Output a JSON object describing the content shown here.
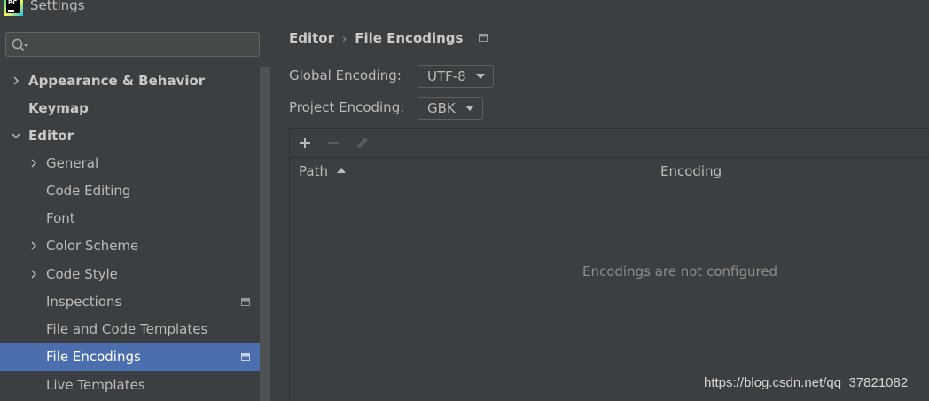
{
  "window": {
    "title": "Settings",
    "app_logo_text": "PC"
  },
  "sidebar": {
    "search": {
      "value": "",
      "placeholder": ""
    },
    "items": [
      {
        "label": "Appearance & Behavior",
        "bold": true,
        "expandable": true
      },
      {
        "label": "Keymap",
        "bold": true,
        "expandable": false
      },
      {
        "label": "Editor",
        "bold": true,
        "expandable": true,
        "expanded": true
      },
      {
        "label": "General",
        "expandable": true
      },
      {
        "label": "Code Editing"
      },
      {
        "label": "Font"
      },
      {
        "label": "Color Scheme",
        "expandable": true
      },
      {
        "label": "Code Style",
        "expandable": true
      },
      {
        "label": "Inspections",
        "icon": "project-level-icon"
      },
      {
        "label": "File and Code Templates"
      },
      {
        "label": "File Encodings",
        "selected": true,
        "icon": "project-level-icon"
      },
      {
        "label": "Live Templates"
      }
    ]
  },
  "main": {
    "breadcrumb": {
      "parent": "Editor",
      "separator": "›",
      "current": "File Encodings"
    },
    "global_encoding": {
      "label": "Global Encoding:",
      "value": "UTF-8"
    },
    "project_encoding": {
      "label": "Project Encoding:",
      "value": "GBK"
    },
    "toolbar": {
      "add_icon": "plus-icon",
      "remove_icon": "minus-icon",
      "edit_icon": "pencil-icon"
    },
    "table": {
      "columns": [
        "Path",
        "Encoding"
      ],
      "sort_column": "Path",
      "sort_direction": "ascending",
      "rows": [],
      "empty_text": "Encodings are not configured"
    }
  },
  "watermark": "https://blog.csdn.net/qq_37821082",
  "colors": {
    "background": "#3c3f41",
    "selection": "#4b6eaf",
    "text": "#bbbbbb",
    "muted_text": "#8c8c8c"
  }
}
